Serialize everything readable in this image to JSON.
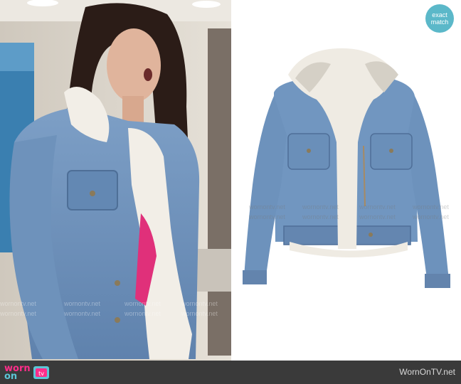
{
  "badge": {
    "line1": "exact",
    "line2": "match"
  },
  "footer": {
    "logo_worn": "worn",
    "logo_on": "on",
    "logo_tv": "tv",
    "site_name": "WornOnTV.net"
  },
  "watermark_text": "wornontv.net",
  "colors": {
    "badge": "#5bb8c9",
    "footer_bg": "#3a3a3a",
    "logo_pink": "#ff2d8a",
    "logo_teal": "#5bc6d6",
    "denim": "#6f93bd",
    "fur": "#f0ece4"
  }
}
